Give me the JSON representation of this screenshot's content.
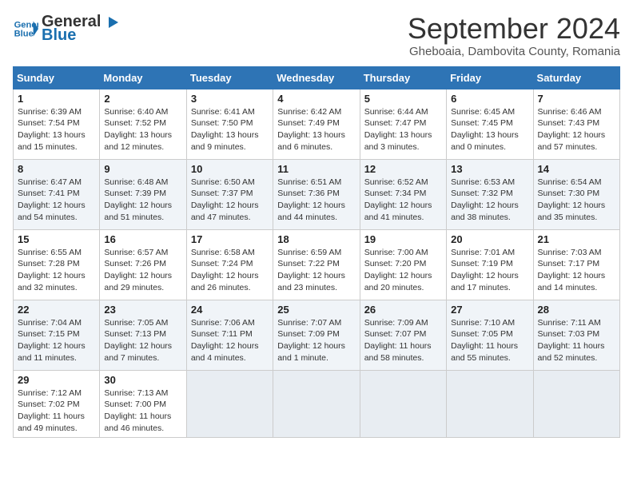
{
  "logo": {
    "line1": "General",
    "line2": "Blue"
  },
  "title": "September 2024",
  "location": "Gheboaia, Dambovita County, Romania",
  "days_of_week": [
    "Sunday",
    "Monday",
    "Tuesday",
    "Wednesday",
    "Thursday",
    "Friday",
    "Saturday"
  ],
  "weeks": [
    [
      {
        "day": "1",
        "sunrise": "6:39 AM",
        "sunset": "7:54 PM",
        "daylight": "13 hours and 15 minutes."
      },
      {
        "day": "2",
        "sunrise": "6:40 AM",
        "sunset": "7:52 PM",
        "daylight": "13 hours and 12 minutes."
      },
      {
        "day": "3",
        "sunrise": "6:41 AM",
        "sunset": "7:50 PM",
        "daylight": "13 hours and 9 minutes."
      },
      {
        "day": "4",
        "sunrise": "6:42 AM",
        "sunset": "7:49 PM",
        "daylight": "13 hours and 6 minutes."
      },
      {
        "day": "5",
        "sunrise": "6:44 AM",
        "sunset": "7:47 PM",
        "daylight": "13 hours and 3 minutes."
      },
      {
        "day": "6",
        "sunrise": "6:45 AM",
        "sunset": "7:45 PM",
        "daylight": "13 hours and 0 minutes."
      },
      {
        "day": "7",
        "sunrise": "6:46 AM",
        "sunset": "7:43 PM",
        "daylight": "12 hours and 57 minutes."
      }
    ],
    [
      {
        "day": "8",
        "sunrise": "6:47 AM",
        "sunset": "7:41 PM",
        "daylight": "12 hours and 54 minutes."
      },
      {
        "day": "9",
        "sunrise": "6:48 AM",
        "sunset": "7:39 PM",
        "daylight": "12 hours and 51 minutes."
      },
      {
        "day": "10",
        "sunrise": "6:50 AM",
        "sunset": "7:37 PM",
        "daylight": "12 hours and 47 minutes."
      },
      {
        "day": "11",
        "sunrise": "6:51 AM",
        "sunset": "7:36 PM",
        "daylight": "12 hours and 44 minutes."
      },
      {
        "day": "12",
        "sunrise": "6:52 AM",
        "sunset": "7:34 PM",
        "daylight": "12 hours and 41 minutes."
      },
      {
        "day": "13",
        "sunrise": "6:53 AM",
        "sunset": "7:32 PM",
        "daylight": "12 hours and 38 minutes."
      },
      {
        "day": "14",
        "sunrise": "6:54 AM",
        "sunset": "7:30 PM",
        "daylight": "12 hours and 35 minutes."
      }
    ],
    [
      {
        "day": "15",
        "sunrise": "6:55 AM",
        "sunset": "7:28 PM",
        "daylight": "12 hours and 32 minutes."
      },
      {
        "day": "16",
        "sunrise": "6:57 AM",
        "sunset": "7:26 PM",
        "daylight": "12 hours and 29 minutes."
      },
      {
        "day": "17",
        "sunrise": "6:58 AM",
        "sunset": "7:24 PM",
        "daylight": "12 hours and 26 minutes."
      },
      {
        "day": "18",
        "sunrise": "6:59 AM",
        "sunset": "7:22 PM",
        "daylight": "12 hours and 23 minutes."
      },
      {
        "day": "19",
        "sunrise": "7:00 AM",
        "sunset": "7:20 PM",
        "daylight": "12 hours and 20 minutes."
      },
      {
        "day": "20",
        "sunrise": "7:01 AM",
        "sunset": "7:19 PM",
        "daylight": "12 hours and 17 minutes."
      },
      {
        "day": "21",
        "sunrise": "7:03 AM",
        "sunset": "7:17 PM",
        "daylight": "12 hours and 14 minutes."
      }
    ],
    [
      {
        "day": "22",
        "sunrise": "7:04 AM",
        "sunset": "7:15 PM",
        "daylight": "12 hours and 11 minutes."
      },
      {
        "day": "23",
        "sunrise": "7:05 AM",
        "sunset": "7:13 PM",
        "daylight": "12 hours and 7 minutes."
      },
      {
        "day": "24",
        "sunrise": "7:06 AM",
        "sunset": "7:11 PM",
        "daylight": "12 hours and 4 minutes."
      },
      {
        "day": "25",
        "sunrise": "7:07 AM",
        "sunset": "7:09 PM",
        "daylight": "12 hours and 1 minute."
      },
      {
        "day": "26",
        "sunrise": "7:09 AM",
        "sunset": "7:07 PM",
        "daylight": "11 hours and 58 minutes."
      },
      {
        "day": "27",
        "sunrise": "7:10 AM",
        "sunset": "7:05 PM",
        "daylight": "11 hours and 55 minutes."
      },
      {
        "day": "28",
        "sunrise": "7:11 AM",
        "sunset": "7:03 PM",
        "daylight": "11 hours and 52 minutes."
      }
    ],
    [
      {
        "day": "29",
        "sunrise": "7:12 AM",
        "sunset": "7:02 PM",
        "daylight": "11 hours and 49 minutes."
      },
      {
        "day": "30",
        "sunrise": "7:13 AM",
        "sunset": "7:00 PM",
        "daylight": "11 hours and 46 minutes."
      },
      null,
      null,
      null,
      null,
      null
    ]
  ]
}
